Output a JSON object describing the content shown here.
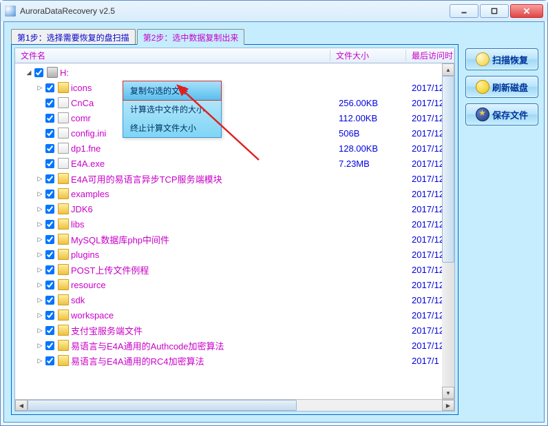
{
  "window": {
    "title": "AuroraDataRecovery v2.5"
  },
  "tabs": [
    {
      "label": "第1步：选择需要恢复的盘扫描"
    },
    {
      "label": "第2步：选中数据复制出来"
    }
  ],
  "columns": {
    "name": "文件名",
    "size": "文件大小",
    "date": "最后访问时"
  },
  "drive": {
    "label": "H:"
  },
  "items": [
    {
      "name": "icons",
      "type": "folder",
      "size": "",
      "date": "2017/12"
    },
    {
      "name": "CnCa",
      "type": "file",
      "size": "256.00KB",
      "date": "2017/12"
    },
    {
      "name": "comr",
      "type": "file",
      "size": "112.00KB",
      "date": "2017/12"
    },
    {
      "name": "config.ini",
      "type": "file",
      "size": "506B",
      "date": "2017/12"
    },
    {
      "name": "dp1.fne",
      "type": "file",
      "size": "128.00KB",
      "date": "2017/12"
    },
    {
      "name": "E4A.exe",
      "type": "file",
      "size": "7.23MB",
      "date": "2017/12"
    },
    {
      "name": "E4A可用的易语言异步TCP服务端模块",
      "type": "folder",
      "size": "",
      "date": "2017/12"
    },
    {
      "name": "examples",
      "type": "folder",
      "size": "",
      "date": "2017/12"
    },
    {
      "name": "JDK6",
      "type": "folder",
      "size": "",
      "date": "2017/12"
    },
    {
      "name": "libs",
      "type": "folder",
      "size": "",
      "date": "2017/12"
    },
    {
      "name": "MySQL数据库php中间件",
      "type": "folder",
      "size": "",
      "date": "2017/12"
    },
    {
      "name": "plugins",
      "type": "folder",
      "size": "",
      "date": "2017/12"
    },
    {
      "name": "POST上传文件例程",
      "type": "folder",
      "size": "",
      "date": "2017/12"
    },
    {
      "name": "resource",
      "type": "folder",
      "size": "",
      "date": "2017/12"
    },
    {
      "name": "sdk",
      "type": "folder",
      "size": "",
      "date": "2017/12"
    },
    {
      "name": "workspace",
      "type": "folder",
      "size": "",
      "date": "2017/12"
    },
    {
      "name": "支付宝服务端文件",
      "type": "folder",
      "size": "",
      "date": "2017/12"
    },
    {
      "name": "易语言与E4A通用的Authcode加密算法",
      "type": "folder",
      "size": "",
      "date": "2017/12"
    },
    {
      "name": "易语言与E4A通用的RC4加密算法",
      "type": "folder",
      "size": "",
      "date": "2017/1"
    }
  ],
  "context_menu": [
    "复制勾选的文件",
    "计算选中文件的大小",
    "终止计算文件大小"
  ],
  "sidebar": {
    "scan": "扫描恢复",
    "refresh": "刷新磁盘",
    "save": "保存文件"
  }
}
